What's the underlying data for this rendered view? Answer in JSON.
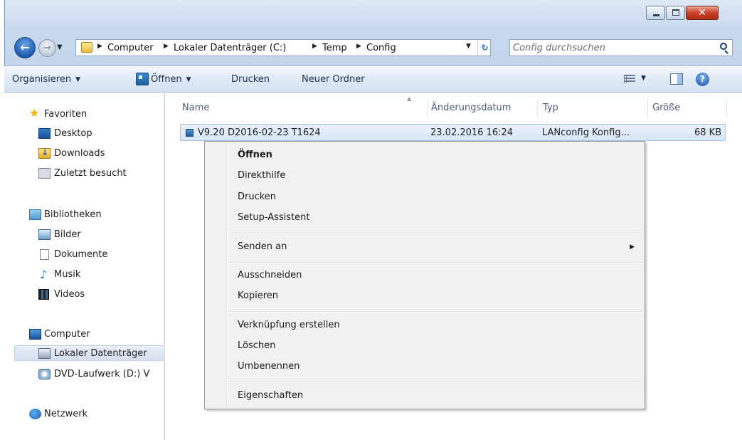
{
  "window": {
    "close_glyph": "✕"
  },
  "navigation": {
    "back_glyph": "←",
    "forward_glyph": "→",
    "dropdown_glyph": "▼"
  },
  "address_bar": {
    "breadcrumbs": [
      "Computer",
      "Lokaler Datenträger (C:)",
      "Temp",
      "Config"
    ],
    "separator": "▶",
    "dropdown_glyph": "▼",
    "refresh_glyph": "↻"
  },
  "search": {
    "placeholder": "Config durchsuchen",
    "icon": "search-icon"
  },
  "toolbar": {
    "organize": "Organisieren",
    "open": "Öffnen",
    "print": "Drucken",
    "new_folder": "Neuer Ordner",
    "dropdown_glyph": "▼",
    "help_glyph": "?"
  },
  "sidebar": {
    "favorites": {
      "label": "Favoriten",
      "items": [
        "Desktop",
        "Downloads",
        "Zuletzt besucht"
      ]
    },
    "libraries": {
      "label": "Bibliotheken",
      "items": [
        "Bilder",
        "Dokumente",
        "Musik",
        "Videos"
      ]
    },
    "computer": {
      "label": "Computer",
      "items": [
        "Lokaler Datenträger",
        "DVD-Laufwerk (D:) V"
      ]
    },
    "network": {
      "label": "Netzwerk"
    }
  },
  "columns": {
    "name": "Name",
    "date": "Änderungsdatum",
    "type": "Typ",
    "size": "Größe",
    "sort_glyph": "▲"
  },
  "files": [
    {
      "name": "V9.20 D2016-02-23 T1624",
      "date": "23.02.2016 16:24",
      "type": "LANconfig Konfig...",
      "size": "68 KB"
    }
  ],
  "context_menu": {
    "items": [
      "Öffnen",
      "Direkthilfe",
      "Drucken",
      "Setup-Assistent",
      "Senden an",
      "Ausschneiden",
      "Kopieren",
      "Verknüpfung erstellen",
      "Löschen",
      "Umbenennen",
      "Eigenschaften"
    ],
    "submenu_glyph": "▶"
  },
  "colors": {
    "chrome_blue": "#c9d9ed",
    "selection_blue": "#d5e6f8",
    "close_red": "#c7432b",
    "menu_bg": "#f1f1f1"
  }
}
